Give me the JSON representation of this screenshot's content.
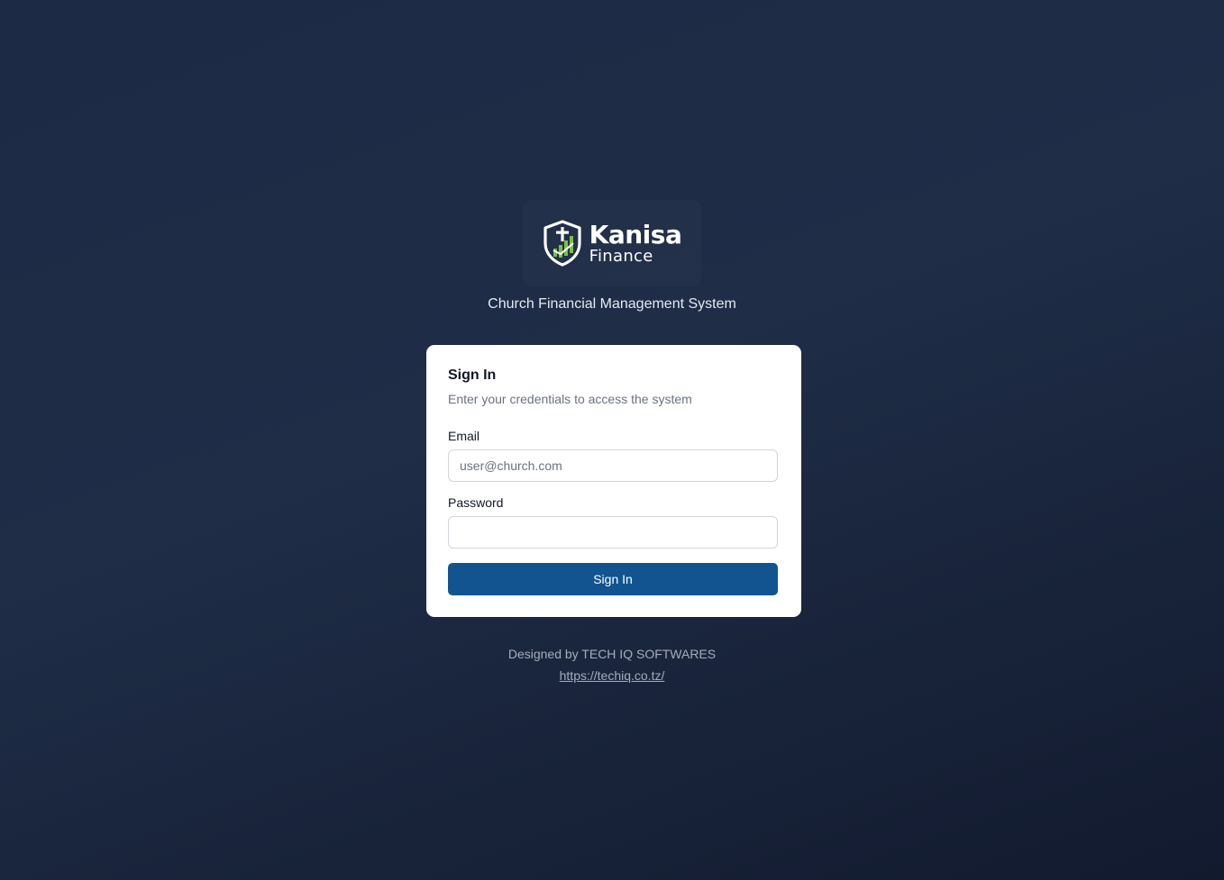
{
  "brand": {
    "name": "Kanisa",
    "sub": "Finance",
    "logo_icon": "shield-cross-chart-icon",
    "colors": {
      "shield": "#ffffff",
      "accent": "#7ac143"
    }
  },
  "tagline": "Church Financial Management System",
  "login": {
    "title": "Sign In",
    "subtitle": "Enter your credentials to access the system",
    "email_label": "Email",
    "email_placeholder": "user@church.com",
    "email_value": "",
    "password_label": "Password",
    "password_value": "",
    "submit_label": "Sign In",
    "button_color": "#115490"
  },
  "footer": {
    "credit": "Designed by TECH IQ SOFTWARES",
    "link_text": "https://techiq.co.tz/"
  }
}
